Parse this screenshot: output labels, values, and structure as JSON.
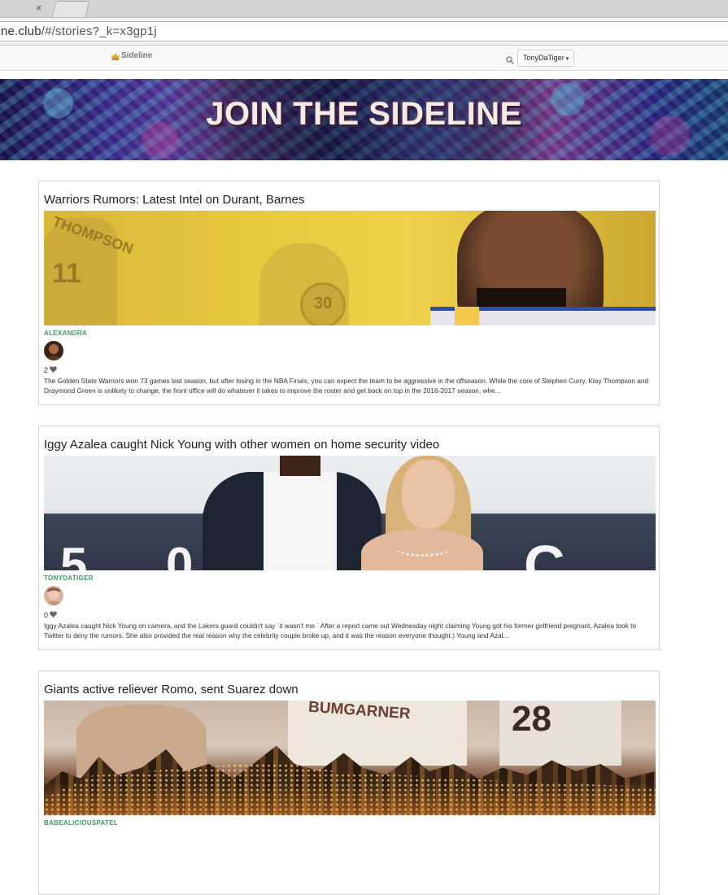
{
  "browser": {
    "tab_close": "×",
    "url_host": "ne.club",
    "url_path": "/#/stories?_k=x3gp1j"
  },
  "nav": {
    "brand": "Sideline",
    "user_label": "TonyDaTiger",
    "caret": "▾"
  },
  "hero": {
    "title": "JOIN THE SIDELINE"
  },
  "stories": [
    {
      "title": "Warriors Rumors: Latest Intel on Durant, Barnes",
      "author": "ALEXANDRA",
      "likes": "2",
      "excerpt": "The Golden State Warriors won 73 games last season, but after losing in the NBA Finals, you can expect the team to be aggressive in the offseason. While the core of Stephen Curry, Klay Thompson and Draymond Green is unlikely to change, the front office will do whatever it takes to improve the roster and get back on top in the 2016-2017 season, whe...",
      "img_text_1": "THOMPSON",
      "img_text_2": "11",
      "img_text_3": "30"
    },
    {
      "title": "Iggy Azalea caught Nick Young with other women on home security video",
      "author": "TONYDATIGER",
      "likes": "0",
      "excerpt": "Iggy Azalea caught Nick Young on camera, and the Lakers guard couldn't say `it wasn't me.` After a report came out Wednesday night claiming Young got his former girlfriend pregnant, Azalea took to Twitter to deny the rumors. She also provided the real reason why the celebrity couple broke up, and it was the reason everyone thought.) Young and Azal...",
      "img_text_1": "5 0",
      "img_text_2": "C"
    },
    {
      "title": "Giants active reliever Romo, sent Suarez down",
      "author": "BABEALICIOUSPATEL",
      "img_text_1": "BUMGARNER",
      "img_text_2": "28"
    }
  ]
}
